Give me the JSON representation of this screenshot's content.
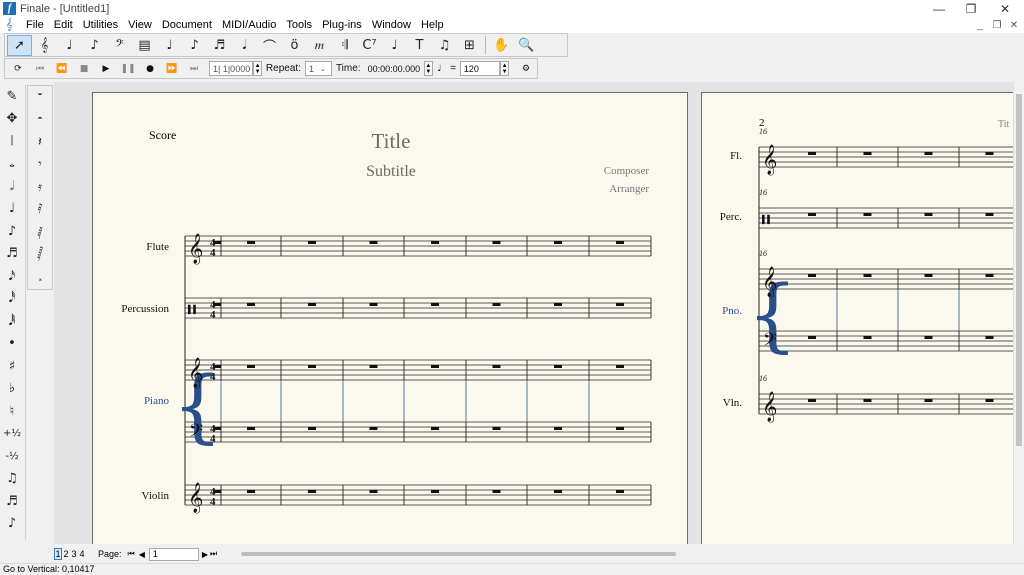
{
  "window": {
    "title": "Finale - [Untitled1]",
    "app_icon": "f",
    "minimize": "—",
    "maximize": "❐",
    "close": "✕"
  },
  "menu": [
    "File",
    "Edit",
    "Utilities",
    "View",
    "Document",
    "MIDI/Audio",
    "Tools",
    "Plug-ins",
    "Window",
    "Help"
  ],
  "mdi_controls": {
    "minimize": "_",
    "restore": "❐",
    "close": "✕"
  },
  "main_tools": [
    {
      "name": "selection-tool-icon",
      "glyph": "➚",
      "active": true
    },
    {
      "name": "staff-tool-icon",
      "glyph": "𝄞"
    },
    {
      "name": "simple-entry-icon",
      "glyph": "♩"
    },
    {
      "name": "speedy-entry-icon",
      "glyph": "♪"
    },
    {
      "name": "clef-tool-icon",
      "glyph": "𝄢"
    },
    {
      "name": "key-signature-icon",
      "glyph": "▤"
    },
    {
      "name": "time-signature-icon",
      "glyph": "♩"
    },
    {
      "name": "note-entry-icon",
      "glyph": "♪"
    },
    {
      "name": "tuplet-tool-icon",
      "glyph": "♬"
    },
    {
      "name": "articulation-tool-icon",
      "glyph": "𝅘𝅥"
    },
    {
      "name": "smart-shape-icon",
      "glyph": "⌒"
    },
    {
      "name": "lyrics-tool-icon",
      "glyph": "ö"
    },
    {
      "name": "expression-tool-icon",
      "glyph": "𝆐"
    },
    {
      "name": "repeat-tool-icon",
      "glyph": "𝄇"
    },
    {
      "name": "chord-tool-icon",
      "glyph": "C⁷"
    },
    {
      "name": "guitar-tool-icon",
      "glyph": "♩"
    },
    {
      "name": "text-tool-icon",
      "glyph": "T"
    },
    {
      "name": "resize-tool-icon",
      "glyph": "♫"
    },
    {
      "name": "page-layout-icon",
      "glyph": "⊞"
    },
    {
      "name": "hand-grabber-icon",
      "glyph": "✋"
    },
    {
      "name": "zoom-tool-icon",
      "glyph": "🔍"
    }
  ],
  "playback": {
    "counter": "1| 1|0000",
    "repeat_label": "Repeat:",
    "repeat_value": "1",
    "time_label": "Time:",
    "time_value": "00:00:00.000",
    "equals": "=",
    "tempo": "120"
  },
  "palette_left": [
    "✎",
    "✥",
    "𝄁",
    "𝅝",
    "𝅗𝅥",
    "♩",
    "♪",
    "♬",
    "𝅘𝅥𝅯",
    "𝅘𝅥𝅰",
    "𝅘𝅥𝅱",
    "•",
    "♯",
    "♭",
    "♮",
    "+½",
    "-½",
    "♫",
    "♬",
    "♪"
  ],
  "palette_right": [
    "𝄻",
    "𝄼",
    "𝄽",
    "𝄾",
    "𝄿",
    "𝅀",
    "𝅁",
    "𝅂",
    "𝅃"
  ],
  "page1": {
    "label": "Score",
    "title": "Title",
    "subtitle": "Subtitle",
    "composer": "Composer",
    "arranger": "Arranger",
    "staves": [
      {
        "name": "Flute",
        "clef": "𝄞",
        "color": "#111111"
      },
      {
        "name": "Percussion",
        "clef": "𝄥",
        "color": "#111111"
      },
      {
        "name": "Piano",
        "clef": "𝄞",
        "clef2": "𝄢",
        "color": "#2a4f8a"
      },
      {
        "name": "Violin",
        "clef": "𝄞",
        "color": "#111111"
      }
    ],
    "time_sig": "4",
    "rest": "𝄼"
  },
  "page2": {
    "page_number": "2",
    "running_title": "Tit",
    "measure_number": "16",
    "staves": [
      {
        "name": "Fl.",
        "clef": "𝄞",
        "color": "#111111"
      },
      {
        "name": "Perc.",
        "clef": "𝄥",
        "color": "#111111"
      },
      {
        "name": "Pno.",
        "clef": "𝄞",
        "clef2": "𝄢",
        "color": "#2a4f8a"
      },
      {
        "name": "Vln.",
        "clef": "𝄞",
        "color": "#111111"
      }
    ]
  },
  "pagebar": {
    "pages": [
      "1",
      "2",
      "3",
      "4"
    ],
    "current": "1",
    "page_label": "Page:",
    "page_value": "1",
    "first": "⏮",
    "prev": "◀",
    "next": "▶",
    "last": "⏭"
  },
  "status": "Go to Vertical: 0,10417"
}
